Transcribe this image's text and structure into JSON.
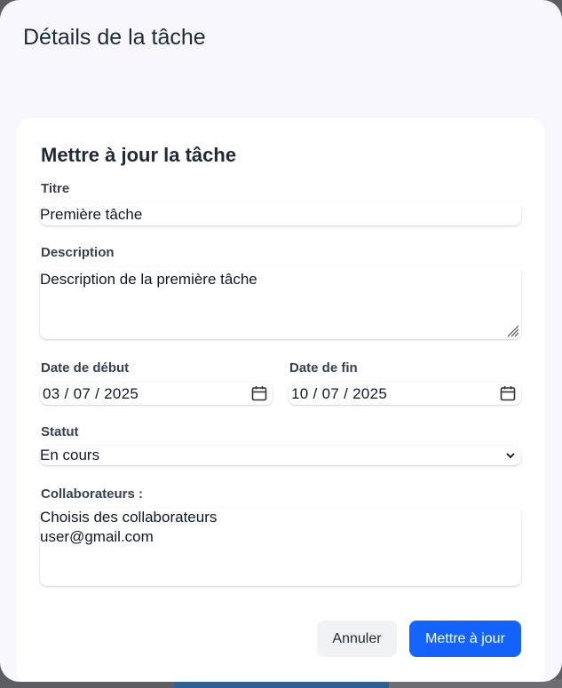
{
  "dialog": {
    "title": "Détails de la tâche"
  },
  "form": {
    "heading": "Mettre à jour la tâche",
    "title_label": "Titre",
    "title_value": "Première tâche",
    "description_label": "Description",
    "description_value": "Description de la première tâche",
    "start_label": "Date de début",
    "start_value": "03 / 07 / 2025",
    "end_label": "Date de fin",
    "end_value": "10 / 07 / 2025",
    "status_label": "Statut",
    "status_value": "En cours",
    "collab_label": "Collaborateurs :",
    "collab_options": [
      "Choisis des collaborateurs",
      "user@gmail.com"
    ],
    "cancel_label": "Annuler",
    "update_label": "Mettre à jour"
  },
  "colors": {
    "primary": "#1463ff",
    "dialog_bg": "#f7f7fd",
    "card_bg": "#ffffff"
  },
  "icons": {
    "date": "calendar-icon",
    "select": "chevron-down-icon",
    "textarea": "resize-handle-icon"
  }
}
